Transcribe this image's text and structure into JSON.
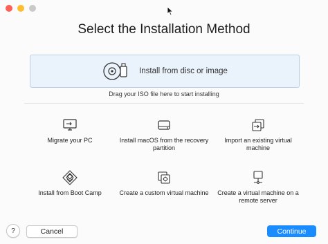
{
  "dialog": {
    "title": "Select the Installation Method"
  },
  "dropzone": {
    "label": "Install from disc or image",
    "hint": "Drag your ISO file here to start installing",
    "icon": "disc-and-usb-icon"
  },
  "options": [
    {
      "label": "Migrate your PC",
      "icon": "monitor-migrate-icon"
    },
    {
      "label": "Install macOS from the recovery partition",
      "icon": "hard-drive-icon"
    },
    {
      "label": "Import an existing virtual machine",
      "icon": "import-vm-icon"
    },
    {
      "label": "Install from Boot Camp",
      "icon": "boot-camp-icon"
    },
    {
      "label": "Create a custom virtual machine",
      "icon": "custom-vm-icon"
    },
    {
      "label": "Create a virtual machine on a remote server",
      "icon": "remote-server-icon"
    }
  ],
  "footer": {
    "help_label": "?",
    "cancel_label": "Cancel",
    "continue_label": "Continue"
  },
  "colors": {
    "accent": "#1a8cff",
    "dropzone_bg": "#eaf2fc"
  }
}
